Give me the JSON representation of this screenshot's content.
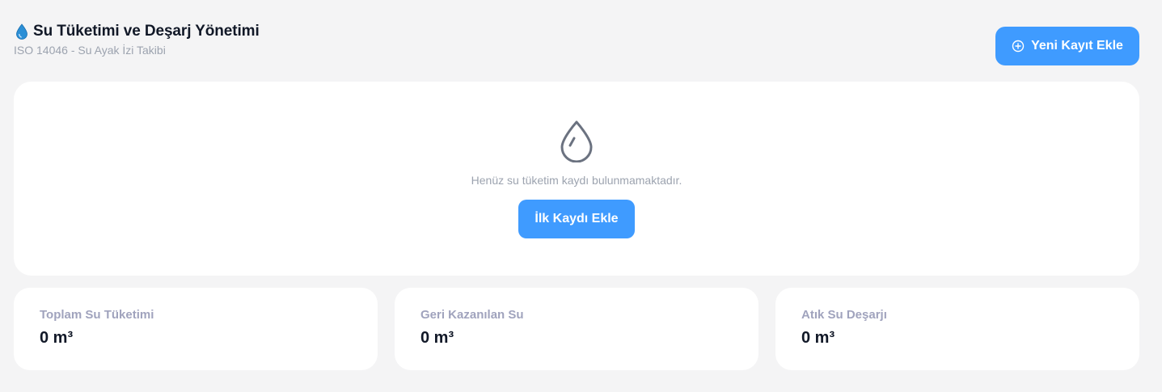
{
  "header": {
    "title_icon": "water-drop-icon",
    "title": "Su Tüketimi ve Deşarj Yönetimi",
    "subtitle": "ISO 14046 - Su Ayak İzi Takibi"
  },
  "actions": {
    "add_icon": "plus-circle-icon",
    "add_label": "Yeni Kayıt Ekle"
  },
  "empty_state": {
    "icon": "water-drop-outline-icon",
    "message": "Henüz su tüketim kaydı bulunmamaktadır.",
    "button_label": "İlk Kaydı Ekle"
  },
  "stats": [
    {
      "label": "Toplam Su Tüketimi",
      "value": "0 m³"
    },
    {
      "label": "Geri Kazanılan Su",
      "value": "0 m³"
    },
    {
      "label": "Atık Su Deşarjı",
      "value": "0 m³"
    }
  ],
  "colors": {
    "accent": "#3f9bff",
    "background": "#f4f4f5",
    "card": "#ffffff",
    "muted_text": "#9ca3af",
    "label_text": "#a0a3bd",
    "drop_icon": "#2b8fd6",
    "empty_icon": "#6b7280"
  }
}
